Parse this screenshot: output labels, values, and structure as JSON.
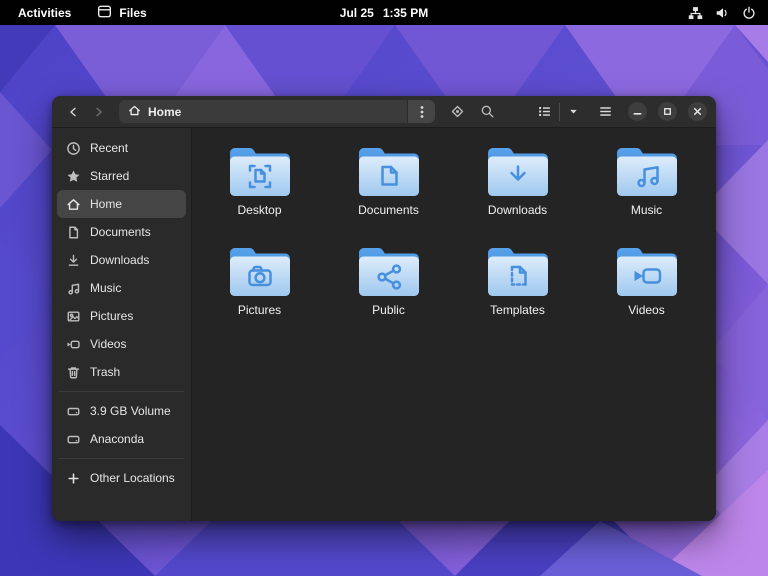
{
  "topbar": {
    "activities_label": "Activities",
    "app_label": "Files",
    "date": "Jul 25",
    "time": "1:35 PM"
  },
  "window": {
    "header": {
      "path_label": "Home"
    },
    "sidebar": {
      "places": [
        {
          "label": "Recent",
          "icon": "recent-icon",
          "selected": false
        },
        {
          "label": "Starred",
          "icon": "starred-icon",
          "selected": false
        },
        {
          "label": "Home",
          "icon": "home-icon",
          "selected": true
        },
        {
          "label": "Documents",
          "icon": "documents-icon",
          "selected": false
        },
        {
          "label": "Downloads",
          "icon": "downloads-icon",
          "selected": false
        },
        {
          "label": "Music",
          "icon": "music-icon",
          "selected": false
        },
        {
          "label": "Pictures",
          "icon": "pictures-icon",
          "selected": false
        },
        {
          "label": "Videos",
          "icon": "videos-icon",
          "selected": false
        },
        {
          "label": "Trash",
          "icon": "trash-icon",
          "selected": false
        }
      ],
      "devices": [
        {
          "label": "3.9 GB Volume",
          "icon": "drive-icon"
        },
        {
          "label": "Anaconda",
          "icon": "drive-icon"
        }
      ],
      "other": [
        {
          "label": "Other Locations",
          "icon": "plus-icon"
        }
      ]
    },
    "folders": [
      {
        "label": "Desktop",
        "glyph": "desktop-glyph"
      },
      {
        "label": "Documents",
        "glyph": "document-glyph"
      },
      {
        "label": "Downloads",
        "glyph": "download-arrow-glyph"
      },
      {
        "label": "Music",
        "glyph": "music-notes-glyph"
      },
      {
        "label": "Pictures",
        "glyph": "camera-glyph"
      },
      {
        "label": "Public",
        "glyph": "share-glyph"
      },
      {
        "label": "Templates",
        "glyph": "template-doc-glyph"
      },
      {
        "label": "Videos",
        "glyph": "video-camera-glyph"
      }
    ]
  },
  "colors": {
    "accent_blue": "#3584e4",
    "folder_back": "#3f7ccd",
    "folder_front": "#aecff1",
    "headerbar_bg": "#2d2d2d",
    "sidebar_bg": "#2a2a2a",
    "content_bg": "#242424",
    "wallpaper_purple": "#7b5dd8",
    "wallpaper_blue": "#4c42c6"
  }
}
